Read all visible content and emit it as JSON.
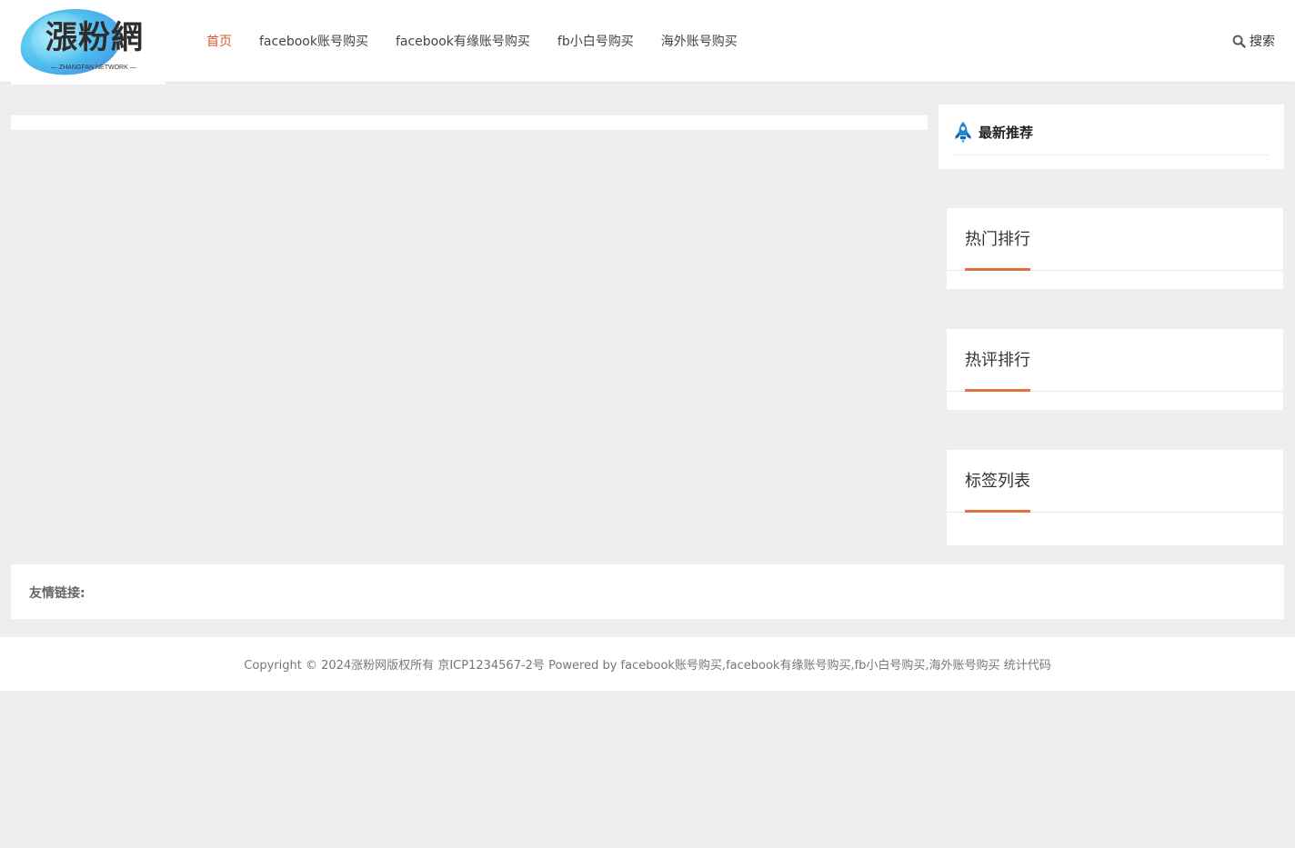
{
  "logo": {
    "text": "漲粉網",
    "subtitle": "— ZHANGFAN NETWORK —"
  },
  "nav": {
    "items": [
      {
        "label": "首页",
        "active": true
      },
      {
        "label": "facebook账号购买",
        "active": false
      },
      {
        "label": "facebook有缘账号购买",
        "active": false
      },
      {
        "label": "fb小白号购买",
        "active": false
      },
      {
        "label": "海外账号购买",
        "active": false
      }
    ],
    "active_color": "#e2572a"
  },
  "search": {
    "label": "搜索",
    "icon": "search-icon"
  },
  "sidebar": {
    "recommend": {
      "title": "最新推荐",
      "icon": "rocket-icon",
      "icon_color": "#1e88d8"
    },
    "widgets": [
      {
        "title": "热门排行"
      },
      {
        "title": "热评排行"
      },
      {
        "title": "标签列表"
      }
    ],
    "accent": "#e2703f"
  },
  "links": {
    "label": "友情链接:"
  },
  "footer": {
    "copyright": "Copyright © 2024涨粉网版权所有",
    "icp": "京ICP1234567-2号",
    "powered": "Powered by facebook账号购买,facebook有缘账号购买,fb小白号购买,海外账号购买",
    "stats": "统计代码"
  }
}
